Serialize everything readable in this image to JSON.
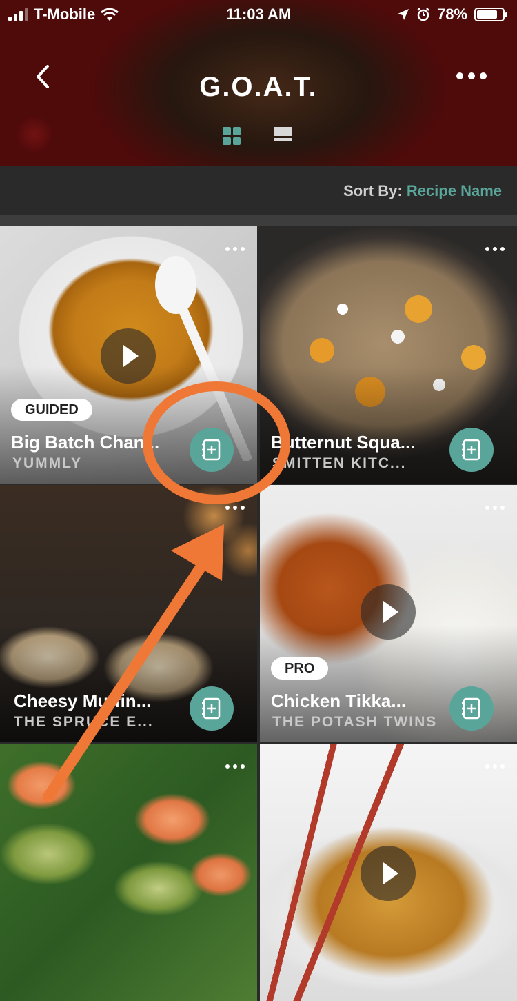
{
  "status_bar": {
    "carrier": "T-Mobile",
    "time": "11:03 AM",
    "battery": "78%",
    "battery_level": 0.78
  },
  "header": {
    "title": "G.O.A.T.",
    "back_icon": "chevron-left-icon",
    "more_icon": "more-horizontal-icon",
    "view_modes": [
      "grid-view-icon",
      "list-view-icon"
    ],
    "active_view": "grid"
  },
  "sort": {
    "label": "Sort By:",
    "value": "Recipe Name"
  },
  "colors": {
    "accent": "#5aa59a",
    "annotation": "#f07836"
  },
  "recipes": [
    {
      "title": "Big Batch Chan...",
      "source": "YUMMLY",
      "badge": "GUIDED",
      "video": true
    },
    {
      "title": "Butternut Squa...",
      "source": "SMITTEN KITC...",
      "badge": "",
      "video": false
    },
    {
      "title": "Cheesy Muffin...",
      "source": "THE SPRUCE E...",
      "badge": "",
      "video": false
    },
    {
      "title": "Chicken Tikka...",
      "source": "THE POTASH TWINS",
      "badge": "PRO",
      "video": true
    },
    {
      "title": "",
      "source": "",
      "badge": "",
      "video": false
    },
    {
      "title": "",
      "source": "",
      "badge": "",
      "video": true
    }
  ]
}
